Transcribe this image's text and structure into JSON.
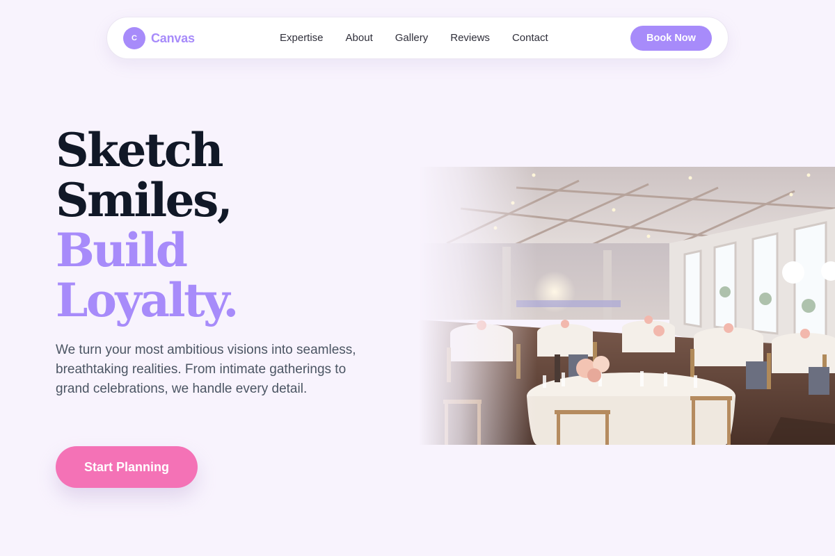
{
  "brand": {
    "mark": "C",
    "name": "Canvas"
  },
  "nav": {
    "links": [
      "Expertise",
      "About",
      "Gallery",
      "Reviews",
      "Contact"
    ],
    "cta": "Book Now"
  },
  "hero": {
    "title_lines": [
      "Sketch",
      "Smiles,"
    ],
    "accent_lines": [
      "Build",
      "Loyalty."
    ],
    "description": "We turn your most ambitious visions into seamless, breathtaking realities. From intimate gatherings to grand celebrations, we handle every detail.",
    "cta": "Start Planning"
  },
  "colors": {
    "background": "#f8f3fd",
    "brand": "#a78bfa",
    "cta": "#f472b6",
    "heading": "#111827",
    "body": "#4b5563"
  },
  "icons": {
    "brand_mark": "circle-letter-logo"
  }
}
